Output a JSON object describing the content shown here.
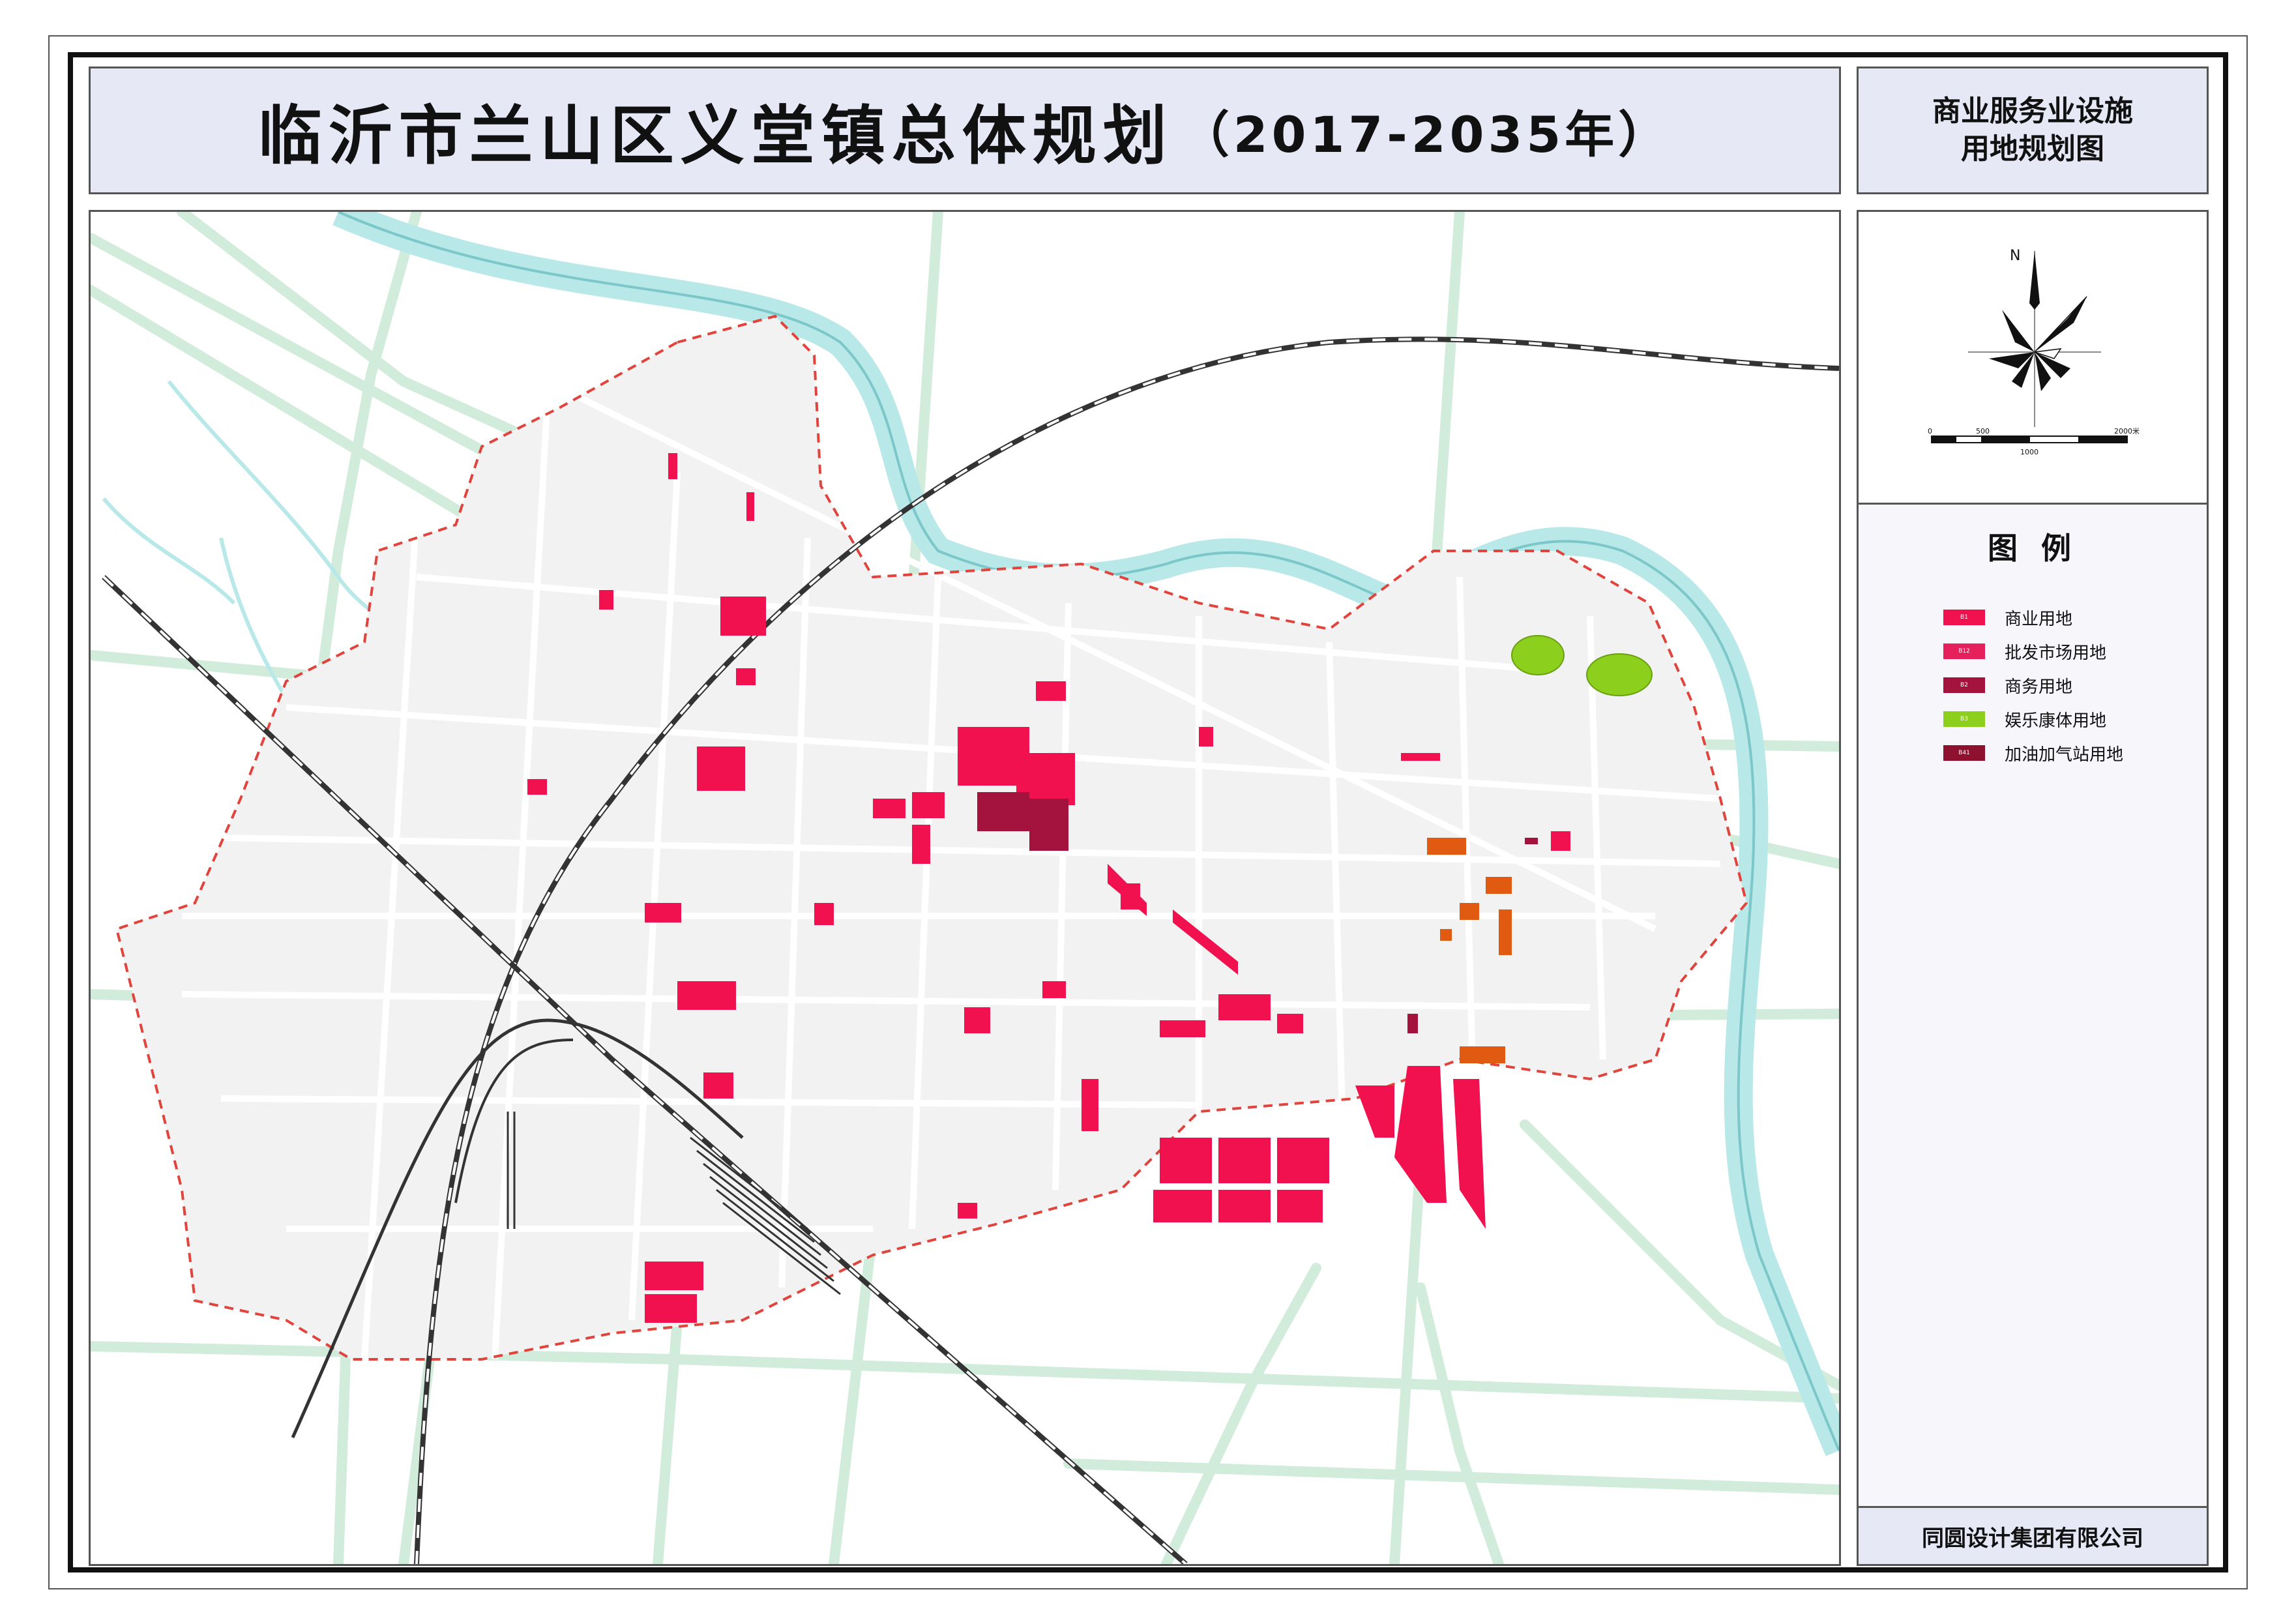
{
  "title": {
    "main": "临沂市兰山区义堂镇总体规划",
    "years": "（2017-2035年）"
  },
  "subtitle": {
    "line1": "商业服务业设施",
    "line2": "用地规划图"
  },
  "compass": {
    "north_label": "N",
    "icon": "compass-rose-icon"
  },
  "scale_bar": {
    "label_0": "0",
    "label_500": "500",
    "label_2000": "2000米",
    "label_1000": "1000"
  },
  "legend": {
    "title": "图 例",
    "items": [
      {
        "code": "B1",
        "label": "商业用地",
        "color": "#f0114e"
      },
      {
        "code": "B12",
        "label": "批发市场用地",
        "color": "#e6205a"
      },
      {
        "code": "B2",
        "label": "商务用地",
        "color": "#a4123e"
      },
      {
        "code": "B3",
        "label": "娱乐康体用地",
        "color": "#8ccf1c"
      },
      {
        "code": "B41",
        "label": "加油加气站用地",
        "color": "#8e1230"
      }
    ]
  },
  "company": "同圆设计集团有限公司",
  "colors": {
    "river": "#b8e8e8",
    "road_green": "#d2ecdc",
    "town_fill": "#f2f2f2",
    "boundary": "#e0443c",
    "railway": "#333333",
    "commercial_orange": "#e05a12"
  }
}
